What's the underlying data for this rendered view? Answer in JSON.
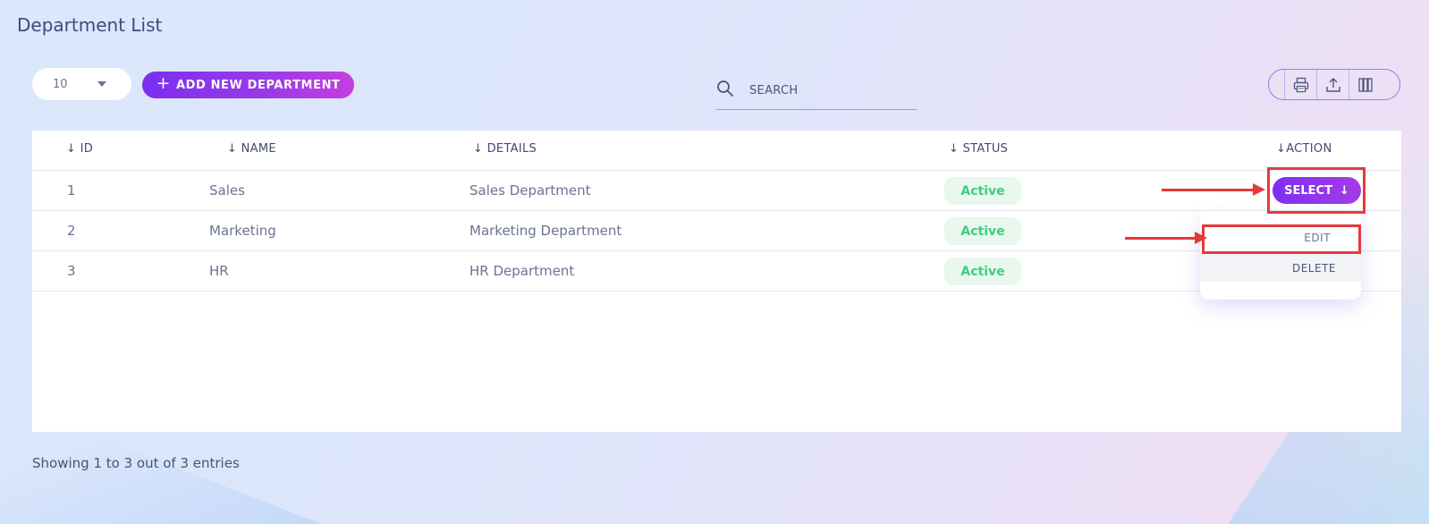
{
  "page": {
    "title": "Department List"
  },
  "toolbar": {
    "page_size": "10",
    "add_button": "ADD NEW DEPARTMENT",
    "search_placeholder": "SEARCH",
    "icons": [
      "printer-icon",
      "upload-icon",
      "columns-icon"
    ]
  },
  "table": {
    "headers": {
      "id": "ID",
      "name": "NAME",
      "details": "DETAILS",
      "status": "STATUS",
      "action": "ACTION"
    },
    "rows": [
      {
        "id": "1",
        "name": "Sales",
        "details": "Sales Department",
        "status": "Active"
      },
      {
        "id": "2",
        "name": "Marketing",
        "details": "Marketing Department",
        "status": "Active"
      },
      {
        "id": "3",
        "name": "HR",
        "details": "HR Department",
        "status": "Active"
      }
    ]
  },
  "action_menu": {
    "select_label": "SELECT",
    "edit": "EDIT",
    "delete": "DELETE"
  },
  "footer": {
    "entries_text": "Showing 1 to 3 out of 3 entries"
  },
  "colors": {
    "accent": "#7b2ff0",
    "status_active": "#3ecf7a",
    "annotation": "#e23b3b"
  }
}
